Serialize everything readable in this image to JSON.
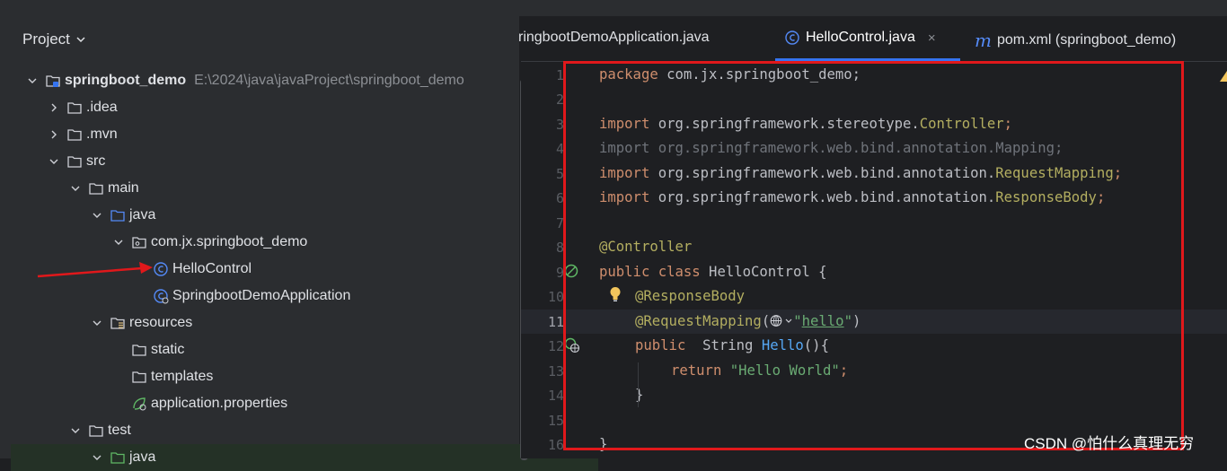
{
  "panel": {
    "title": "Project"
  },
  "tree": [
    {
      "label": "springboot_demo",
      "path": "E:\\2024\\java\\javaProject\\springboot_demo",
      "icon": "module-folder-icon",
      "expanded": true
    },
    {
      "label": ".idea",
      "icon": "folder-icon",
      "expanded": false
    },
    {
      "label": ".mvn",
      "icon": "folder-icon",
      "expanded": false
    },
    {
      "label": "src",
      "icon": "folder-icon",
      "expanded": true
    },
    {
      "label": "main",
      "icon": "folder-icon",
      "expanded": true
    },
    {
      "label": "java",
      "icon": "source-folder-icon",
      "expanded": true
    },
    {
      "label": "com.jx.springboot_demo",
      "icon": "package-icon",
      "expanded": true
    },
    {
      "label": "HelloControl",
      "icon": "java-class-icon"
    },
    {
      "label": "SpringbootDemoApplication",
      "icon": "spring-boot-class-icon"
    },
    {
      "label": "resources",
      "icon": "resources-folder-icon",
      "expanded": true
    },
    {
      "label": "static",
      "icon": "folder-icon"
    },
    {
      "label": "templates",
      "icon": "folder-icon"
    },
    {
      "label": "application.properties",
      "icon": "spring-properties-icon"
    },
    {
      "label": "test",
      "icon": "folder-icon",
      "expanded": true
    },
    {
      "label": "java",
      "icon": "test-folder-icon",
      "expanded": true
    }
  ],
  "tabs": [
    {
      "label": "ringbootDemoApplication.java",
      "icon": "java-class-icon",
      "active": false
    },
    {
      "label": "HelloControl.java",
      "icon": "java-class-icon",
      "active": true,
      "close": "×"
    },
    {
      "label": "pom.xml (springboot_demo)",
      "icon": "maven-icon",
      "active": false
    }
  ],
  "editor": {
    "line_numbers": [
      "1",
      "2",
      "3",
      "4",
      "5",
      "6",
      "7",
      "8",
      "9",
      "10",
      "11",
      "12",
      "13",
      "14",
      "15",
      "16"
    ],
    "current_line": "11",
    "code": {
      "l1_kw": "package",
      "l1_rest": " com.jx.springboot_demo;",
      "l3_kw": "import",
      "l3_pkg": " org.springframework.stereotype.",
      "l3_cls": "Controller",
      "l3_end": ";",
      "l4": "import org.springframework.web.bind.annotation.Mapping;",
      "l5_kw": "import",
      "l5_pkg": " org.springframework.web.bind.annotation.",
      "l5_cls": "RequestMapping",
      "l5_end": ";",
      "l6_kw": "import",
      "l6_pkg": " org.springframework.web.bind.annotation.",
      "l6_cls": "ResponseBody",
      "l6_end": ";",
      "l8": "@Controller",
      "l9_kw": "public class",
      "l9_rest": " HelloControl {",
      "l10": "@ResponseBody",
      "l11_ann": "@RequestMapping",
      "l11_open": "(",
      "l11_str_q1": "\"",
      "l11_str": "hello",
      "l11_str_q2": "\"",
      "l11_close": ")",
      "l12_kw": "public",
      "l12_type": "  String ",
      "l12_fn": "Hello",
      "l12_rest": "(){",
      "l13_kw": "return",
      "l13_str": " \"Hello World\"",
      "l13_end": ";",
      "l14": "}",
      "l16": "}"
    }
  },
  "watermark": "CSDN @怕什么真理无穷",
  "colors": {
    "highlight_box": "#e0181b",
    "arrow": "#e0181b",
    "accent": "#3574f0"
  }
}
